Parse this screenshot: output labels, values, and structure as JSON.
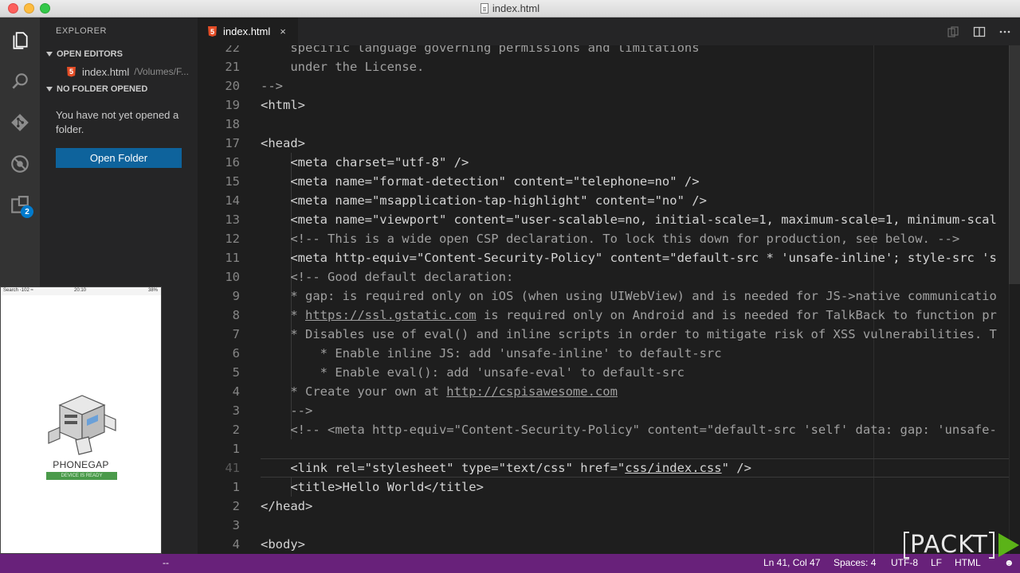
{
  "window": {
    "title": "index.html"
  },
  "activity_bar": {
    "items": [
      "files-icon",
      "search-icon",
      "git-icon",
      "debug-icon",
      "extensions-icon"
    ],
    "extensions_badge": "2"
  },
  "sidebar": {
    "title": "EXPLORER",
    "open_editors_label": "OPEN EDITORS",
    "open_editor_item": {
      "name": "index.html",
      "path": "/Volumes/F..."
    },
    "no_folder_label": "NO FOLDER OPENED",
    "no_folder_message": "You have not yet opened a folder.",
    "open_folder_button": "Open Folder"
  },
  "tab": {
    "label": "index.html",
    "close": "×"
  },
  "editor": {
    "lines": [
      {
        "num": "22",
        "text": "    specific language governing permissions and limitations",
        "cls": "com"
      },
      {
        "num": "21",
        "text": "    under the License.",
        "cls": "com"
      },
      {
        "num": "20",
        "text": "-->",
        "cls": "com"
      },
      {
        "num": "19",
        "text": "<html>",
        "cls": ""
      },
      {
        "num": "18",
        "text": "",
        "cls": ""
      },
      {
        "num": "17",
        "text": "<head>",
        "cls": ""
      },
      {
        "num": "16",
        "text": "    <meta charset=\"utf-8\" />",
        "cls": ""
      },
      {
        "num": "15",
        "text": "    <meta name=\"format-detection\" content=\"telephone=no\" />",
        "cls": ""
      },
      {
        "num": "14",
        "text": "    <meta name=\"msapplication-tap-highlight\" content=\"no\" />",
        "cls": ""
      },
      {
        "num": "13",
        "text": "    <meta name=\"viewport\" content=\"user-scalable=no, initial-scale=1, maximum-scale=1, minimum-scal",
        "cls": ""
      },
      {
        "num": "12",
        "text": "    <!-- This is a wide open CSP declaration. To lock this down for production, see below. -->",
        "cls": "com"
      },
      {
        "num": "11",
        "text": "    <meta http-equiv=\"Content-Security-Policy\" content=\"default-src * 'unsafe-inline'; style-src 's",
        "cls": ""
      },
      {
        "num": "10",
        "text": "    <!-- Good default declaration:",
        "cls": "com"
      },
      {
        "num": "9",
        "text": "    * gap: is required only on iOS (when using UIWebView) and is needed for JS->native communicatio",
        "cls": "com"
      },
      {
        "num": "8",
        "pre": "    * ",
        "link": "https://ssl.gstatic.com",
        "post": " is required only on Android and is needed for TalkBack to function pr",
        "cls": "com"
      },
      {
        "num": "7",
        "text": "    * Disables use of eval() and inline scripts in order to mitigate risk of XSS vulnerabilities. T",
        "cls": "com"
      },
      {
        "num": "6",
        "text": "        * Enable inline JS: add 'unsafe-inline' to default-src",
        "cls": "com"
      },
      {
        "num": "5",
        "text": "        * Enable eval(): add 'unsafe-eval' to default-src",
        "cls": "com"
      },
      {
        "num": "4",
        "pre": "    * Create your own at ",
        "link": "http://cspisawesome.com",
        "post": "",
        "cls": "com"
      },
      {
        "num": "3",
        "text": "    -->",
        "cls": "com"
      },
      {
        "num": "2",
        "text": "    <!-- <meta http-equiv=\"Content-Security-Policy\" content=\"default-src 'self' data: gap: 'unsafe-",
        "cls": "com"
      },
      {
        "num": "1",
        "text": "",
        "cls": ""
      },
      {
        "num": "41",
        "pre": "    <link rel=\"stylesheet\" type=\"text/css\" href=\"",
        "link": "css/index.css",
        "post": "\" />",
        "cls": "",
        "current": true
      },
      {
        "num": "1",
        "text": "    <title>Hello World</title>",
        "cls": ""
      },
      {
        "num": "2",
        "text": "</head>",
        "cls": ""
      },
      {
        "num": "3",
        "text": "",
        "cls": ""
      },
      {
        "num": "4",
        "text": "<body>",
        "cls": ""
      }
    ]
  },
  "status_bar": {
    "left": "--",
    "position": "Ln 41, Col 47",
    "spaces": "Spaces: 4",
    "encoding": "UTF-8",
    "eol": "LF",
    "language": "HTML",
    "feedback": "☻"
  },
  "phone_preview": {
    "carrier": "Search ◦102 ≈",
    "time": "20:10",
    "battery": "38%",
    "app_name": "PHONEGAP",
    "status_label": "DEVICE IS READY"
  },
  "watermark": {
    "text": "PACKT"
  },
  "colors": {
    "status_bar": "#68217a",
    "accent": "#0e639c",
    "editor_bg": "#1e1e1e"
  }
}
